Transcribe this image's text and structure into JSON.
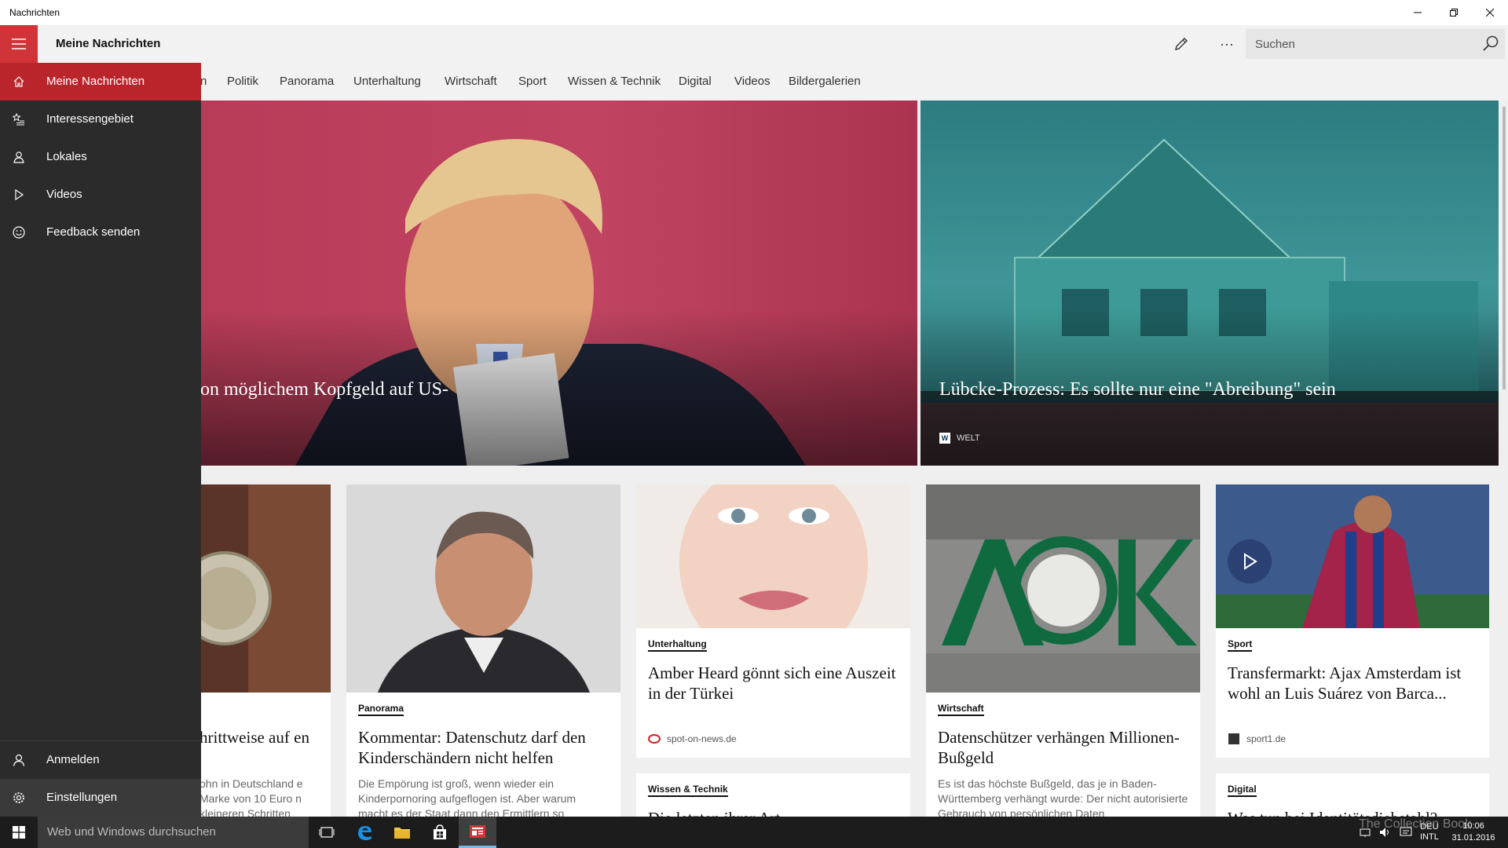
{
  "window": {
    "title": "Nachrichten"
  },
  "header": {
    "title": "Meine Nachrichten",
    "search_placeholder": "Suchen",
    "more_label": "···"
  },
  "categories": [
    "Politik",
    "Panorama",
    "Unterhaltung",
    "Wirtschaft",
    "Sport",
    "Wissen & Technik",
    "Digital",
    "Videos",
    "Bildergalerien"
  ],
  "cat_partial": "n",
  "nav": {
    "items": [
      {
        "label": "Meine Nachrichten",
        "icon": "home-icon"
      },
      {
        "label": "Interessengebiet",
        "icon": "star-list-icon"
      },
      {
        "label": "Lokales",
        "icon": "person-pin-icon"
      },
      {
        "label": "Videos",
        "icon": "play-icon"
      },
      {
        "label": "Feedback senden",
        "icon": "smiley-icon"
      }
    ],
    "bottom": [
      {
        "label": "Anmelden",
        "icon": "person-icon"
      },
      {
        "label": "Einstellungen",
        "icon": "gear-icon"
      }
    ]
  },
  "hero": {
    "left": {
      "title": "on möglichem Kopfgeld auf US-"
    },
    "right": {
      "title": "Lübcke-Prozess:  Es sollte nur eine \"Abreibung\" sein",
      "source": "WELT"
    }
  },
  "cards": {
    "c0": {
      "title": "hrittweise auf en",
      "desc": "ohn in Deutschland e Marke von 10 Euro n kleineren Schritten"
    },
    "c1": {
      "category": "Panorama",
      "title": "Kommentar: Datenschutz darf den Kinderschändern nicht helfen",
      "desc": "Die Empörung ist groß, wenn wieder ein Kinderpornoring aufgeflogen ist. Aber warum macht es der Staat dann den Ermittlern so"
    },
    "c2": {
      "category": "Unterhaltung",
      "title": "Amber Heard gönnt sich eine Auszeit in der Türkei",
      "source": "spot-on-news.de"
    },
    "c3": {
      "category": "Wirtschaft",
      "title": "Datenschützer verhängen Millionen-Bußgeld",
      "desc": "Es ist das höchste Bußgeld, das je in Baden-Württemberg verhängt wurde: Der nicht autorisierte Gebrauch von persönlichen Daten"
    },
    "c4": {
      "category": "Sport",
      "title": "Transfermarkt: Ajax Amsterdam ist wohl an Luis Suárez von Barca...",
      "source": "sport1.de"
    },
    "c5": {
      "category": "Wissen & Technik",
      "title": "Die letzten ihrer Art"
    },
    "c6": {
      "category": "Digital",
      "title": "Was tun bei Identitätsdiebstahl?"
    }
  },
  "taskbar": {
    "search_placeholder": "Web und Windows durchsuchen",
    "lang_top": "DEU",
    "lang_bottom": "INTL",
    "time": "10:06",
    "date": "31.01.2016"
  },
  "watermark": "The Collection Book",
  "colors": {
    "accent": "#d13438",
    "nav_bg": "#2b2b2b",
    "nav_active": "#b9252b",
    "taskbar": "#1c1c1c"
  }
}
